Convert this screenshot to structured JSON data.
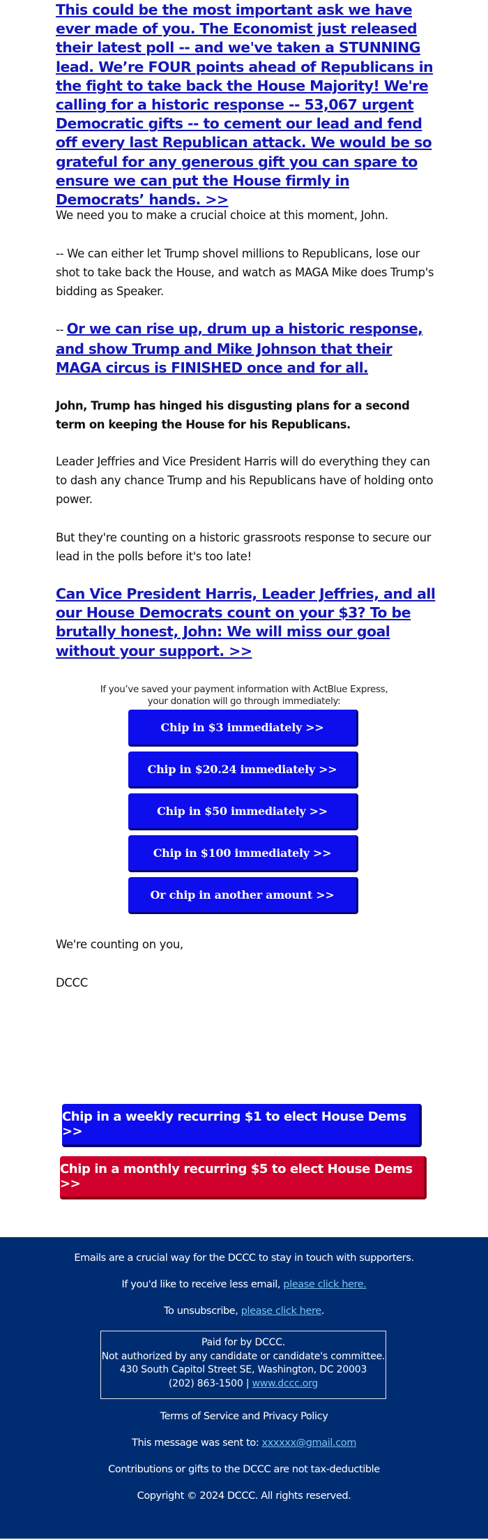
{
  "email": {
    "lead_link": "This could be the most important ask we have ever made of you. The Economist just released their latest poll -- and we've taken a STUNNING lead. We’re FOUR points ahead of Republicans in the fight to take back the House Majority! We're calling for a historic response -- 53,067 urgent Democratic gifts -- to cement our lead and fend off every last Republican attack. We would be so grateful for any generous gift you can spare to ensure we can put the House firmly in Democrats’ hands. >>",
    "choice_intro": "We need you to make a crucial choice at this moment, John.",
    "choice_a": "-- We can either let Trump shovel millions to Republicans, lose our shot to take back the House, and watch as MAGA Mike does Trump's bidding as Speaker.",
    "choice_b_prefix": "-- ",
    "choice_b_link": "Or we can rise up, drum up a historic response, and show Trump and Mike Johnson that their MAGA circus is FINISHED once and for all.",
    "bold_para": "John, Trump has hinged his disgusting plans for a second term on keeping the House for his Republicans.",
    "para_leaders": "Leader Jeffries and Vice President Harris will do everything they can to dash any chance Trump and his Republicans have of holding onto power.",
    "para_counting": "But they're counting on a historic grassroots response to secure our lead in the polls before it's too late!",
    "ask_link": "Can Vice President Harris, Leader Jeffries, and all our House Democrats count on your $3? To be brutally honest, John: We will miss our goal without your support. >>",
    "actblue_note_line1": "If you’ve saved your payment information with ActBlue Express,",
    "actblue_note_line2": "your donation will go through immediately:",
    "chip_buttons": [
      {
        "label": "Chip in $3 immediately >>"
      },
      {
        "label": "Chip in $20.24 immediately >>"
      },
      {
        "label": "Chip in $50 immediately >>"
      },
      {
        "label": "Chip in $100 immediately >>"
      },
      {
        "label": "Or chip in another amount >>"
      }
    ],
    "signoff": "We're counting on you,",
    "signature": "DCCC",
    "recurring_weekly": "Chip in a weekly recurring $1 to elect House Dems >>",
    "recurring_monthly": "Chip in a monthly recurring $5 to elect House Dems >>"
  },
  "colors": {
    "link_blue": "#1418b8",
    "button_blue": "#0d0ded",
    "button_red": "#cf002b",
    "footer_bg": "#002d72",
    "footer_link": "#7cc4f2"
  },
  "footer": {
    "emails_note": "Emails are a crucial way for the DCCC to stay in touch with supporters.",
    "less_email_prefix": "If you'd like to receive less email, ",
    "less_email_link": "please click here.",
    "unsubscribe_prefix": "To unsubscribe, ",
    "unsubscribe_link": "please click here",
    "unsubscribe_suffix": ".",
    "paid_for": "Paid for by DCCC.",
    "not_authorized": "Not authorized by any candidate or candidate's committee.",
    "address": "430 South Capitol Street SE, Washington, DC 20003",
    "phone": "(202) 863-1500 | ",
    "website": "www.dccc.org",
    "terms": "Terms of Service and Privacy Policy",
    "sent_to_prefix": "This message was sent to: ",
    "sent_to_email": "xxxxxx@gmail.com",
    "tax_note": "Contributions or gifts to the DCCC are not tax-deductible",
    "copyright": "Copyright © 2024 DCCC. All rights reserved."
  }
}
